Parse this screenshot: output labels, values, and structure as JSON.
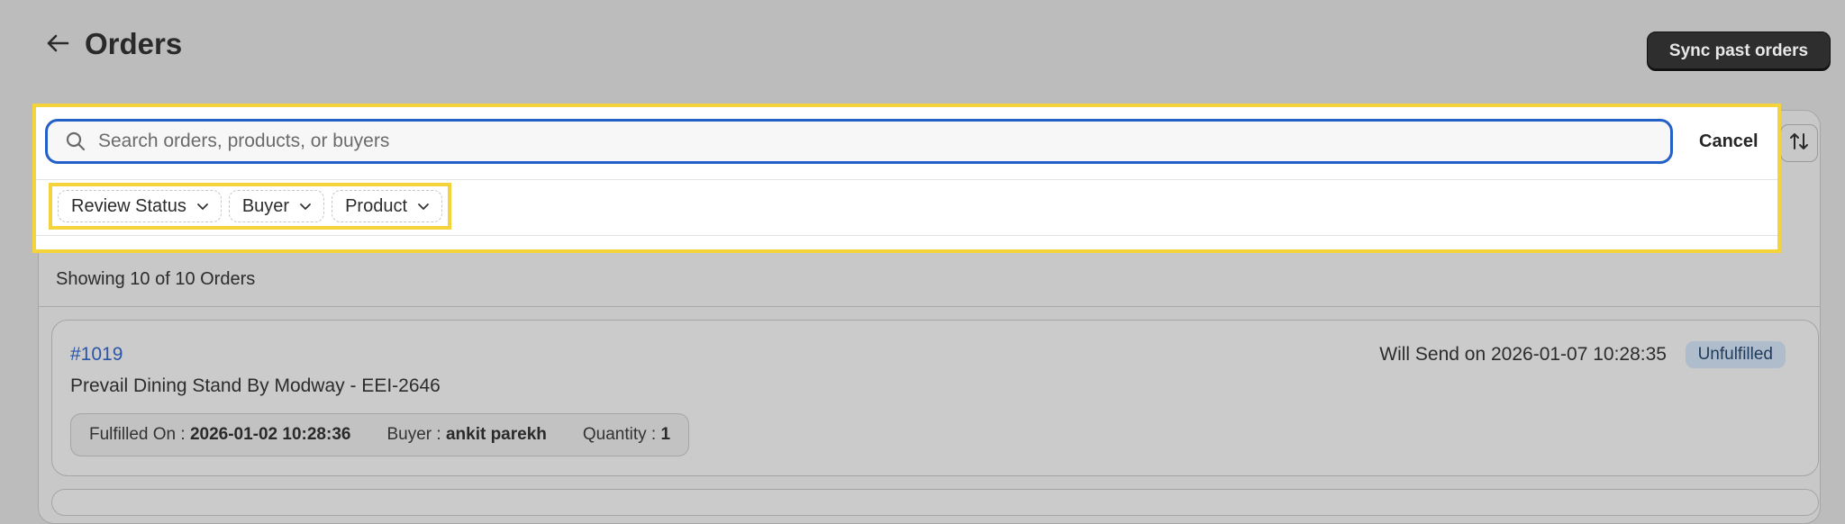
{
  "header": {
    "title": "Orders",
    "sync_label": "Sync past orders"
  },
  "search": {
    "placeholder": "Search orders, products, or buyers",
    "value": "",
    "cancel_label": "Cancel"
  },
  "filters": [
    {
      "label": "Review Status"
    },
    {
      "label": "Buyer"
    },
    {
      "label": "Product"
    }
  ],
  "summary": {
    "count_text": "Showing 10 of 10 Orders"
  },
  "orders": [
    {
      "number": "#1019",
      "product": "Prevail Dining Stand By Modway - EEI-2646",
      "send_text": "Will Send on 2026-01-07 10:28:35",
      "status": "Unfulfilled",
      "fulfilled_label": "Fulfilled On :",
      "fulfilled_value": "2026-01-02 10:28:36",
      "buyer_label": "Buyer :",
      "buyer_value": "ankit parekh",
      "quantity_label": "Quantity :",
      "quantity_value": "1"
    }
  ],
  "icons": {
    "back": "arrow-left-icon",
    "search": "search-icon",
    "sort": "sort-icon",
    "chevron": "chevron-down-icon"
  },
  "colors": {
    "accent": "#2360c8",
    "highlight": "#f5d33a",
    "link": "#2a55a8",
    "badge_bg": "#afbccb"
  }
}
